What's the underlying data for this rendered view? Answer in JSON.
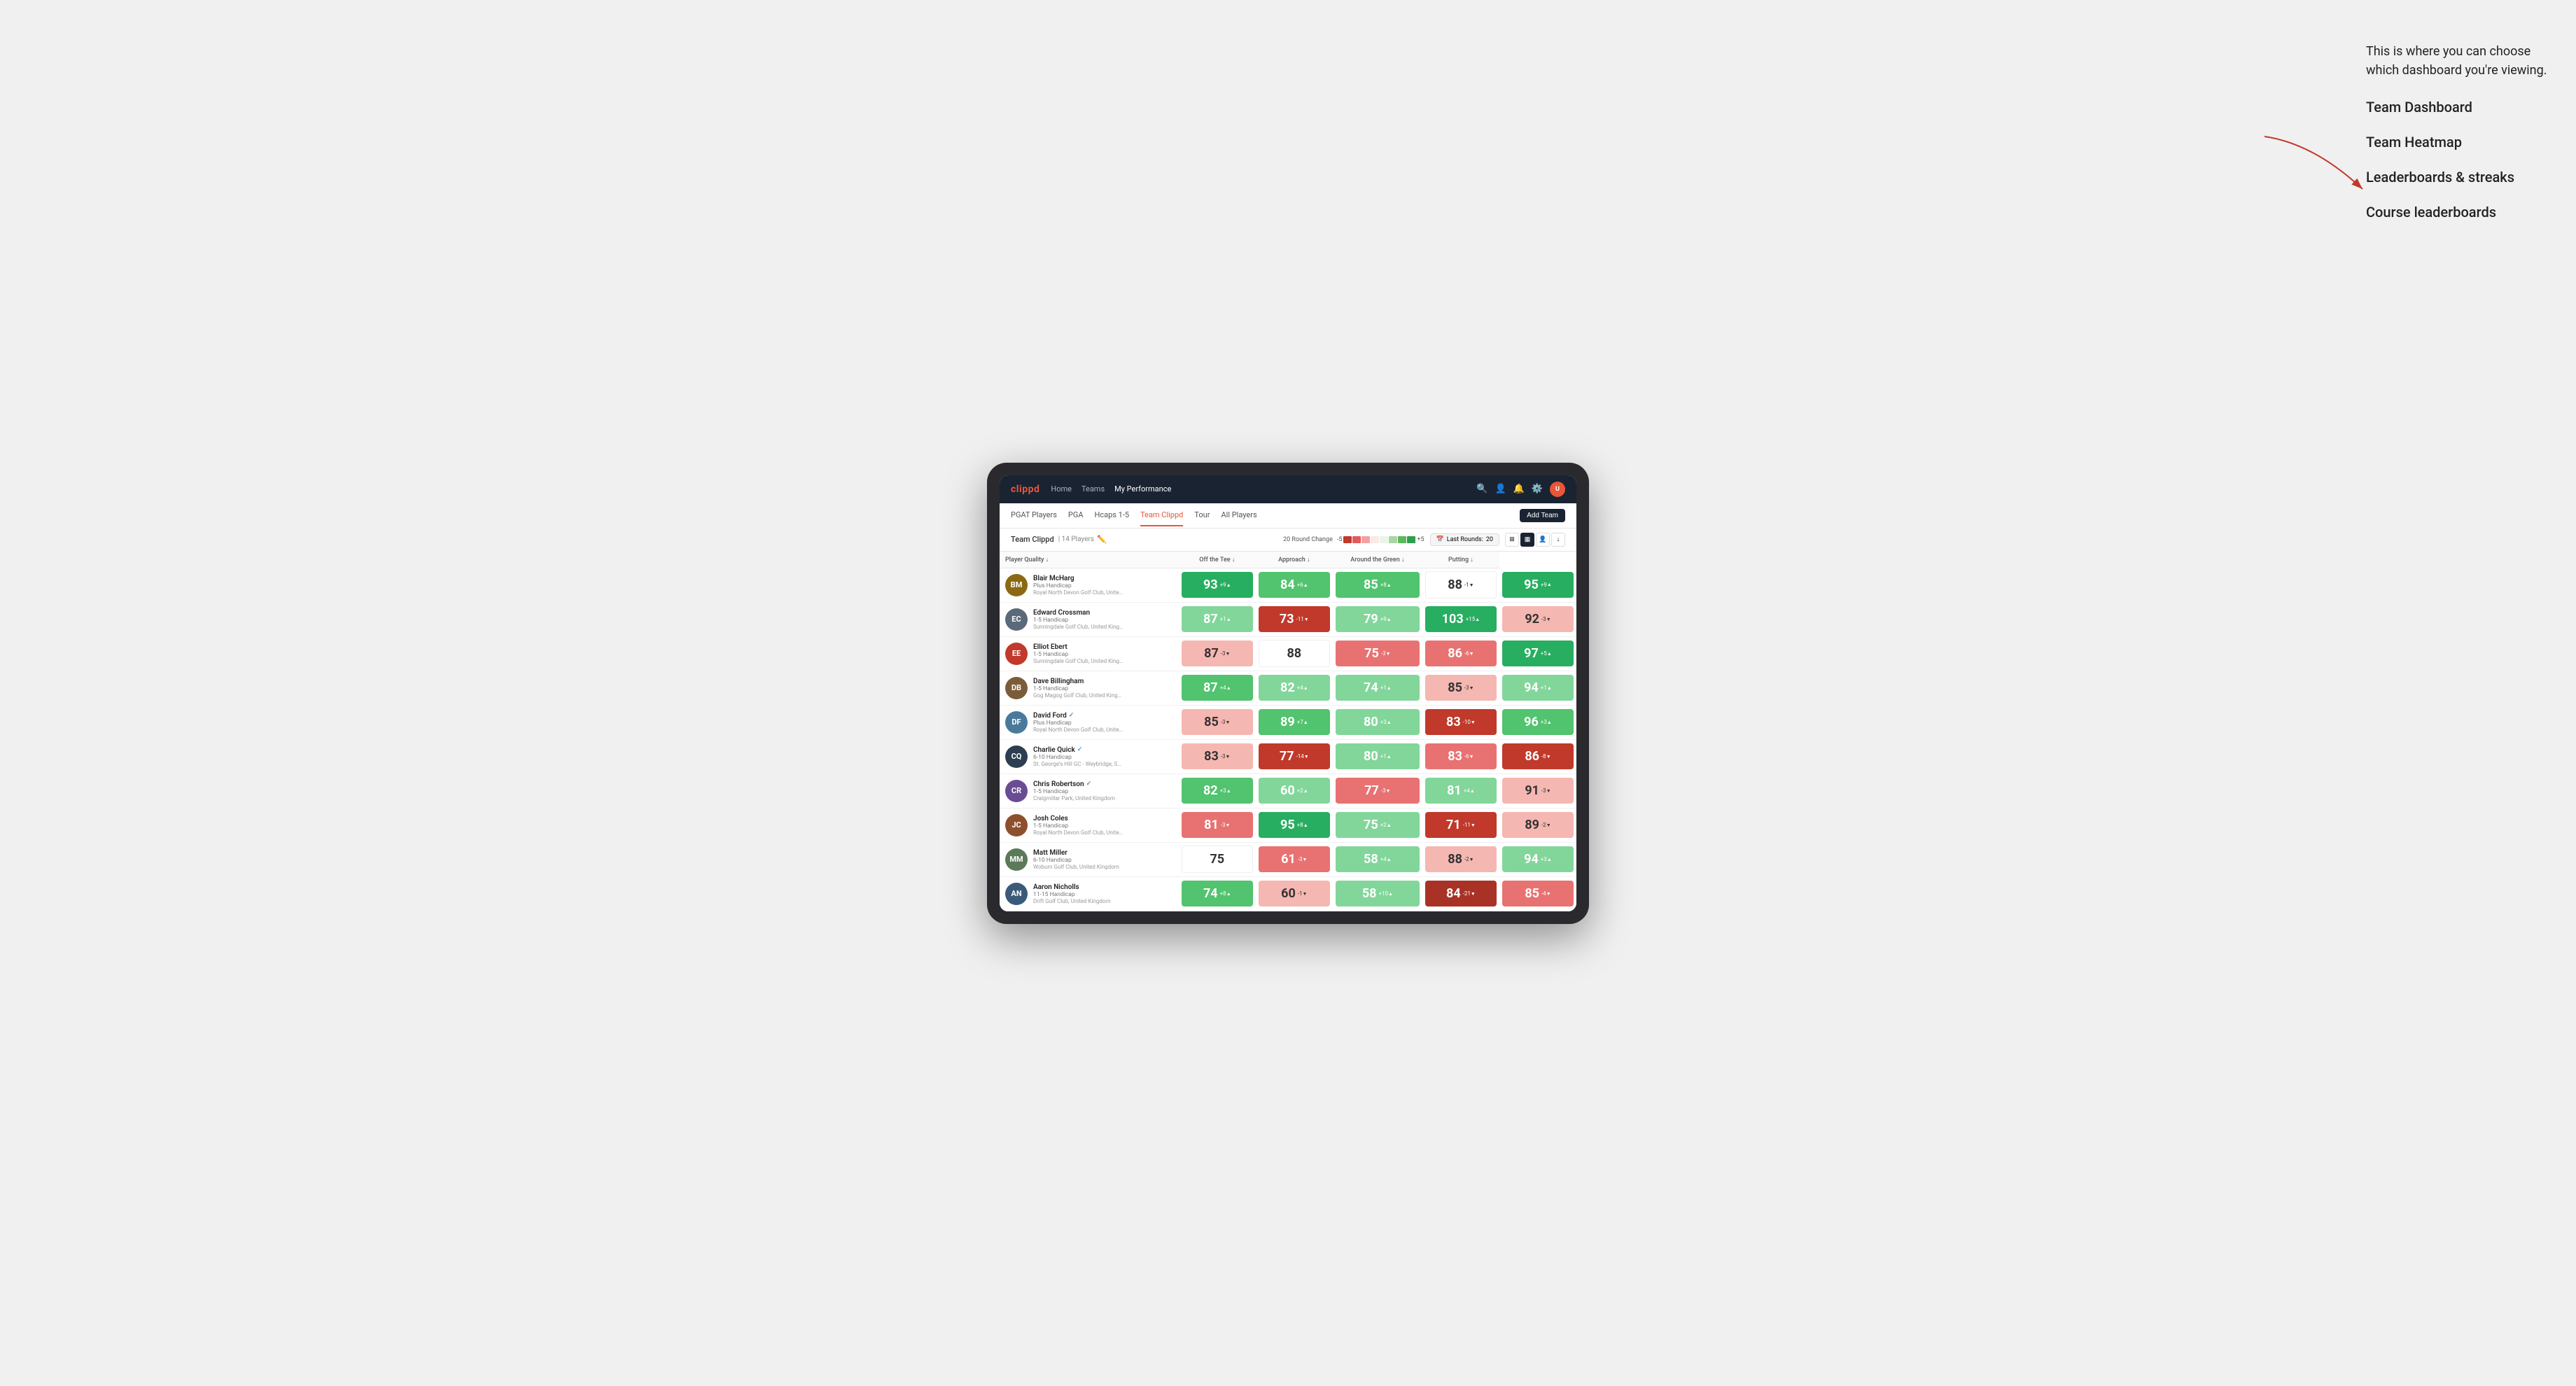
{
  "annotation": {
    "intro": "This is where you can choose which dashboard you're viewing.",
    "items": [
      "Team Dashboard",
      "Team Heatmap",
      "Leaderboards & streaks",
      "Course leaderboards"
    ]
  },
  "nav": {
    "logo": "clippd",
    "links": [
      "Home",
      "Teams",
      "My Performance"
    ],
    "active_link": "My Performance",
    "icons": [
      "search",
      "profile",
      "bell",
      "settings",
      "avatar"
    ]
  },
  "sub_nav": {
    "links": [
      "PGAT Players",
      "PGA",
      "Hcaps 1-5",
      "Team Clippd",
      "Tour",
      "All Players"
    ],
    "active": "Team Clippd",
    "add_team_label": "Add Team"
  },
  "team_header": {
    "name": "Team Clippd",
    "separator": "|",
    "count": "14 Players",
    "round_change_label": "20 Round Change",
    "scale_neg": "-5",
    "scale_pos": "+5",
    "last_rounds_label": "Last Rounds:",
    "last_rounds_value": "20"
  },
  "table": {
    "columns": [
      "Player Quality ↓",
      "Off the Tee ↓",
      "Approach ↓",
      "Around the Green ↓",
      "Putting ↓"
    ],
    "players": [
      {
        "name": "Blair McHarg",
        "handicap": "Plus Handicap",
        "club": "Royal North Devon Golf Club, United Kingdom",
        "verified": false,
        "avatar_color": "#8B6914",
        "scores": [
          {
            "value": 93,
            "change": "+9",
            "dir": "up",
            "color": "c-g3"
          },
          {
            "value": 84,
            "change": "+6",
            "dir": "up",
            "color": "c-g2"
          },
          {
            "value": 85,
            "change": "+8",
            "dir": "up",
            "color": "c-g2"
          },
          {
            "value": 88,
            "change": "-1",
            "dir": "down",
            "color": "c-w"
          },
          {
            "value": 95,
            "change": "+9",
            "dir": "up",
            "color": "c-g3"
          }
        ]
      },
      {
        "name": "Edward Crossman",
        "handicap": "1-5 Handicap",
        "club": "Sunningdale Golf Club, United Kingdom",
        "verified": false,
        "avatar_color": "#5a6a7a",
        "scores": [
          {
            "value": 87,
            "change": "+1",
            "dir": "up",
            "color": "c-g1"
          },
          {
            "value": 73,
            "change": "-11",
            "dir": "down",
            "color": "c-r3"
          },
          {
            "value": 79,
            "change": "+9",
            "dir": "up",
            "color": "c-g1"
          },
          {
            "value": 103,
            "change": "+15",
            "dir": "up",
            "color": "c-g3"
          },
          {
            "value": 92,
            "change": "-3",
            "dir": "down",
            "color": "c-r1"
          }
        ]
      },
      {
        "name": "Elliot Ebert",
        "handicap": "1-5 Handicap",
        "club": "Sunningdale Golf Club, United Kingdom",
        "verified": false,
        "avatar_color": "#c0392b",
        "scores": [
          {
            "value": 87,
            "change": "-3",
            "dir": "down",
            "color": "c-r1"
          },
          {
            "value": 88,
            "change": "",
            "dir": "",
            "color": "c-w"
          },
          {
            "value": 75,
            "change": "-3",
            "dir": "down",
            "color": "c-r2"
          },
          {
            "value": 86,
            "change": "-6",
            "dir": "down",
            "color": "c-r2"
          },
          {
            "value": 97,
            "change": "+5",
            "dir": "up",
            "color": "c-g3"
          }
        ]
      },
      {
        "name": "Dave Billingham",
        "handicap": "1-5 Handicap",
        "club": "Gog Magog Golf Club, United Kingdom",
        "verified": false,
        "avatar_color": "#7a5c3a",
        "scores": [
          {
            "value": 87,
            "change": "+4",
            "dir": "up",
            "color": "c-g2"
          },
          {
            "value": 82,
            "change": "+4",
            "dir": "up",
            "color": "c-g1"
          },
          {
            "value": 74,
            "change": "+1",
            "dir": "up",
            "color": "c-g1"
          },
          {
            "value": 85,
            "change": "-3",
            "dir": "down",
            "color": "c-r1"
          },
          {
            "value": 94,
            "change": "+1",
            "dir": "up",
            "color": "c-g1"
          }
        ]
      },
      {
        "name": "David Ford",
        "handicap": "Plus Handicap",
        "club": "Royal North Devon Golf Club, United Kingdom",
        "verified": true,
        "avatar_color": "#4a7a9b",
        "scores": [
          {
            "value": 85,
            "change": "-3",
            "dir": "down",
            "color": "c-r1"
          },
          {
            "value": 89,
            "change": "+7",
            "dir": "up",
            "color": "c-g2"
          },
          {
            "value": 80,
            "change": "+3",
            "dir": "up",
            "color": "c-g1"
          },
          {
            "value": 83,
            "change": "-10",
            "dir": "down",
            "color": "c-r3"
          },
          {
            "value": 96,
            "change": "+3",
            "dir": "up",
            "color": "c-g2"
          }
        ]
      },
      {
        "name": "Charlie Quick",
        "handicap": "6-10 Handicap",
        "club": "St. George's Hill GC - Weybridge, Surrey, Uni...",
        "verified": true,
        "avatar_color": "#2c3e50",
        "scores": [
          {
            "value": 83,
            "change": "-3",
            "dir": "down",
            "color": "c-r1"
          },
          {
            "value": 77,
            "change": "-14",
            "dir": "down",
            "color": "c-r3"
          },
          {
            "value": 80,
            "change": "+1",
            "dir": "up",
            "color": "c-g1"
          },
          {
            "value": 83,
            "change": "-6",
            "dir": "down",
            "color": "c-r2"
          },
          {
            "value": 86,
            "change": "-8",
            "dir": "down",
            "color": "c-r3"
          }
        ]
      },
      {
        "name": "Chris Robertson",
        "handicap": "1-5 Handicap",
        "club": "Craigmillar Park, United Kingdom",
        "verified": true,
        "avatar_color": "#6a4c93",
        "scores": [
          {
            "value": 82,
            "change": "+3",
            "dir": "up",
            "color": "c-g2"
          },
          {
            "value": 60,
            "change": "+2",
            "dir": "up",
            "color": "c-g1"
          },
          {
            "value": 77,
            "change": "-3",
            "dir": "down",
            "color": "c-r2"
          },
          {
            "value": 81,
            "change": "+4",
            "dir": "up",
            "color": "c-g1"
          },
          {
            "value": 91,
            "change": "-3",
            "dir": "down",
            "color": "c-r1"
          }
        ]
      },
      {
        "name": "Josh Coles",
        "handicap": "1-5 Handicap",
        "club": "Royal North Devon Golf Club, United Kingdom",
        "verified": false,
        "avatar_color": "#8e4f2d",
        "scores": [
          {
            "value": 81,
            "change": "-3",
            "dir": "down",
            "color": "c-r2"
          },
          {
            "value": 95,
            "change": "+8",
            "dir": "up",
            "color": "c-g3"
          },
          {
            "value": 75,
            "change": "+2",
            "dir": "up",
            "color": "c-g1"
          },
          {
            "value": 71,
            "change": "-11",
            "dir": "down",
            "color": "c-r3"
          },
          {
            "value": 89,
            "change": "-2",
            "dir": "down",
            "color": "c-r1"
          }
        ]
      },
      {
        "name": "Matt Miller",
        "handicap": "6-10 Handicap",
        "club": "Woburn Golf Club, United Kingdom",
        "verified": false,
        "avatar_color": "#5a7a5a",
        "scores": [
          {
            "value": 75,
            "change": "",
            "dir": "",
            "color": "c-w"
          },
          {
            "value": 61,
            "change": "-3",
            "dir": "down",
            "color": "c-r2"
          },
          {
            "value": 58,
            "change": "+4",
            "dir": "up",
            "color": "c-g1"
          },
          {
            "value": 88,
            "change": "-2",
            "dir": "down",
            "color": "c-r1"
          },
          {
            "value": 94,
            "change": "+3",
            "dir": "up",
            "color": "c-g1"
          }
        ]
      },
      {
        "name": "Aaron Nicholls",
        "handicap": "11-15 Handicap",
        "club": "Drift Golf Club, United Kingdom",
        "verified": false,
        "avatar_color": "#3a5a7a",
        "scores": [
          {
            "value": 74,
            "change": "+8",
            "dir": "up",
            "color": "c-g2"
          },
          {
            "value": 60,
            "change": "-1",
            "dir": "down",
            "color": "c-r1"
          },
          {
            "value": 58,
            "change": "+10",
            "dir": "up",
            "color": "c-g1"
          },
          {
            "value": 84,
            "change": "-21",
            "dir": "down",
            "color": "c-r4"
          },
          {
            "value": 85,
            "change": "-4",
            "dir": "down",
            "color": "c-r2"
          }
        ]
      }
    ]
  },
  "scale_colors": [
    "#c0392b",
    "#e05c5c",
    "#f4a0a0",
    "#fce8e8",
    "#e8f5e8",
    "#a8d5a2",
    "#5cb85c",
    "#2e9e4f"
  ]
}
